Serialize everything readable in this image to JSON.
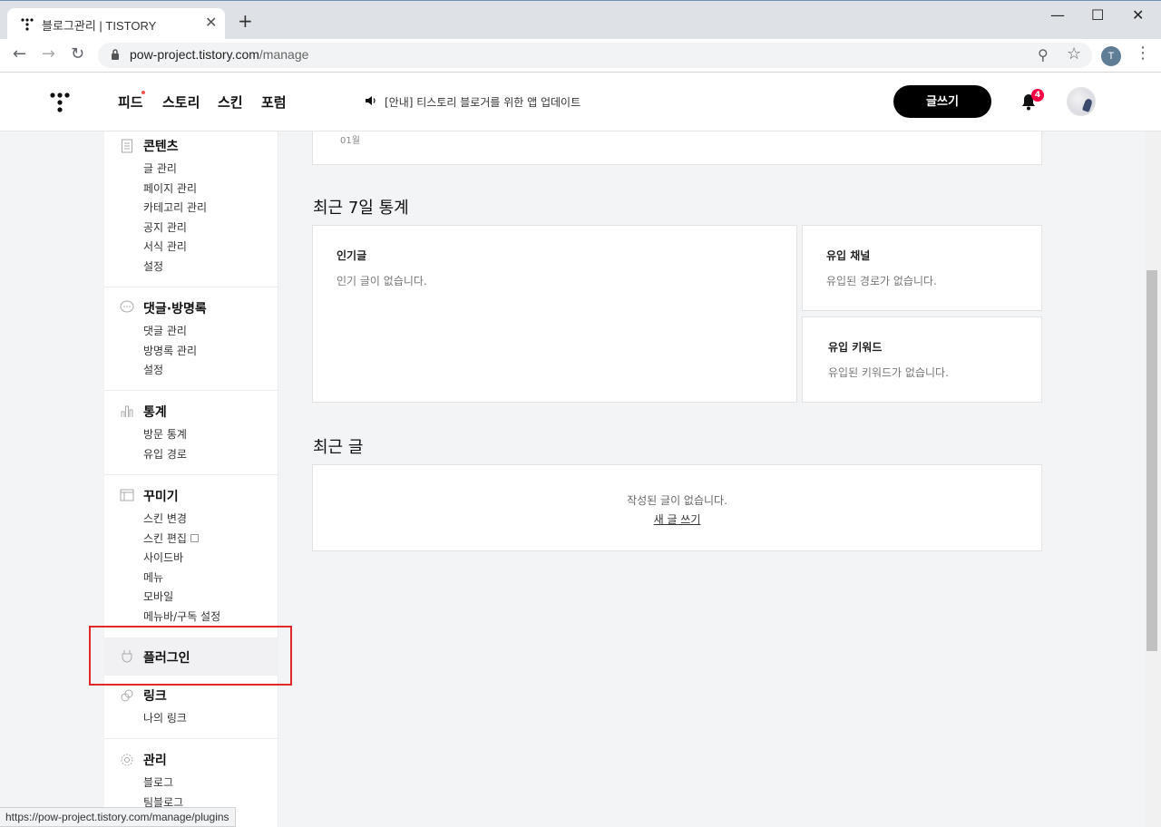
{
  "browser": {
    "tab_title": "블로그관리 | TISTORY",
    "new_tab": "+",
    "url_host": "pow-project.tistory.com",
    "url_path": "/manage",
    "profile_initial": "T",
    "status_url": "https://pow-project.tistory.com/manage/plugins"
  },
  "header": {
    "nav": [
      "피드",
      "스토리",
      "스킨",
      "포럼"
    ],
    "notice": "[안내] 티스토리 블로거를 위한 앱 업데이트",
    "write_label": "글쓰기",
    "notification_count": "4"
  },
  "sidebar": {
    "content": {
      "title": "콘텐츠",
      "items": [
        "글 관리",
        "페이지 관리",
        "카테고리 관리",
        "공지 관리",
        "서식 관리",
        "설정"
      ]
    },
    "comments": {
      "title": "댓글·방명록",
      "items": [
        "댓글 관리",
        "방명록 관리",
        "설정"
      ]
    },
    "stats": {
      "title": "통계",
      "items": [
        "방문 통계",
        "유입 경로"
      ]
    },
    "decorate": {
      "title": "꾸미기",
      "items": [
        "스킨 변경",
        "스킨 편집",
        "사이드바",
        "메뉴",
        "모바일",
        "메뉴바/구독 설정"
      ]
    },
    "plugin": {
      "title": "플러그인"
    },
    "link": {
      "title": "링크",
      "items": [
        "나의 링크"
      ]
    },
    "manage": {
      "title": "관리",
      "items": [
        "블로그",
        "팀블로그"
      ]
    }
  },
  "main": {
    "month_label": "01월",
    "stats_title": "최근 7일 통계",
    "popular": {
      "title": "인기글",
      "empty": "인기 글이 없습니다."
    },
    "channel": {
      "title": "유입 채널",
      "empty": "유입된 경로가 없습니다."
    },
    "keyword": {
      "title": "유입 키워드",
      "empty": "유입된 키워드가 없습니다."
    },
    "recent_title": "최근 글",
    "recent_empty": "작성된 글이 없습니다.",
    "new_post_link": "새 글 쓰기"
  },
  "colors": {
    "accent": "#000000",
    "highlight": "#e02828",
    "badge": "#ff0044"
  }
}
